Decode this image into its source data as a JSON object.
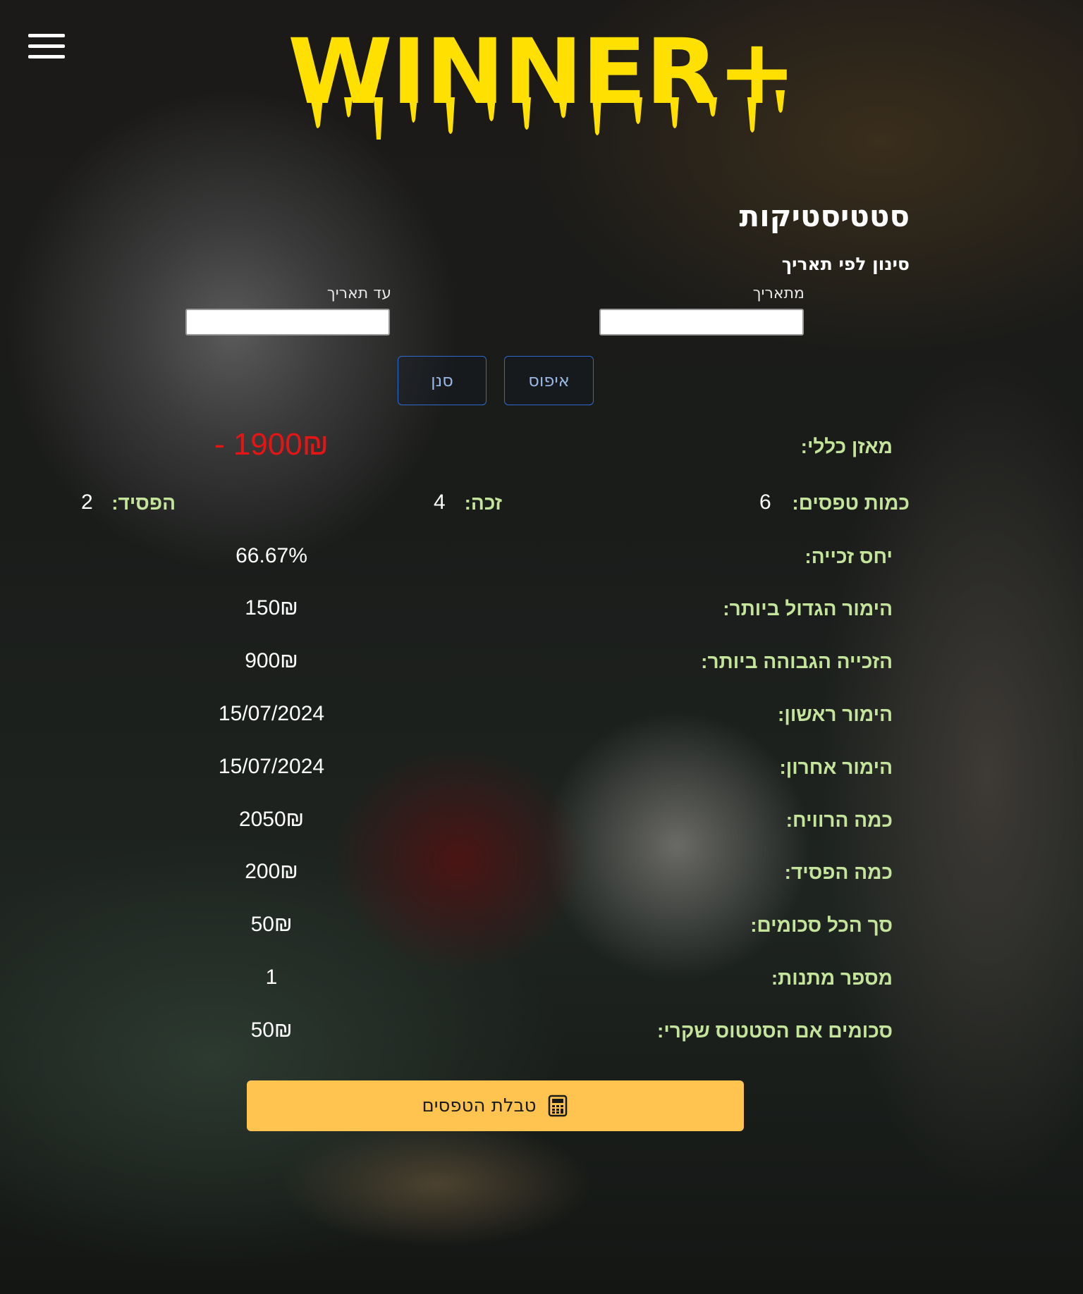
{
  "header": {
    "logo_text": "WINNER+",
    "logo_color": "#ffe000",
    "menu_icon": "hamburger-menu-icon"
  },
  "page": {
    "title": "סטטיסטיקות",
    "filter_title": "סינון לפי תאריך"
  },
  "filter": {
    "from_label": "מתאריך",
    "from_value": "",
    "to_label": "עד תאריך",
    "to_value": "",
    "reset_label": "איפוס",
    "apply_label": "סנן"
  },
  "stats": {
    "balance_label": "מאזן כללי:",
    "balance_value": "- 1900₪",
    "balance_color": "#e51515",
    "bets_count_label": "כמות טפסים:",
    "bets_count_value": "6",
    "won_label": "זכה:",
    "won_value": "4",
    "lost_label": "הפסיד:",
    "lost_value": "2",
    "rows": [
      {
        "label": "יחס זכייה:",
        "value": "66.67%"
      },
      {
        "label": "הימור הגדול ביותר:",
        "value": "150₪"
      },
      {
        "label": "הזכייה הגבוהה ביותר:",
        "value": "900₪"
      },
      {
        "label": "הימור ראשון:",
        "value": "15/07/2024"
      },
      {
        "label": "הימור אחרון:",
        "value": "15/07/2024"
      },
      {
        "label": "כמה הרוויח:",
        "value": "2050₪"
      },
      {
        "label": "כמה הפסיד:",
        "value": "200₪"
      },
      {
        "label": "סך הכל סכומים:",
        "value": "50₪"
      },
      {
        "label": "מספר מתנות:",
        "value": "1"
      },
      {
        "label": "סכומים אם הסטטוס שקרי:",
        "value": "50₪"
      }
    ]
  },
  "actions": {
    "table_button_label": "טבלת הטפסים",
    "table_button_icon": "calculator-icon",
    "accent_color": "#ffc34f"
  }
}
